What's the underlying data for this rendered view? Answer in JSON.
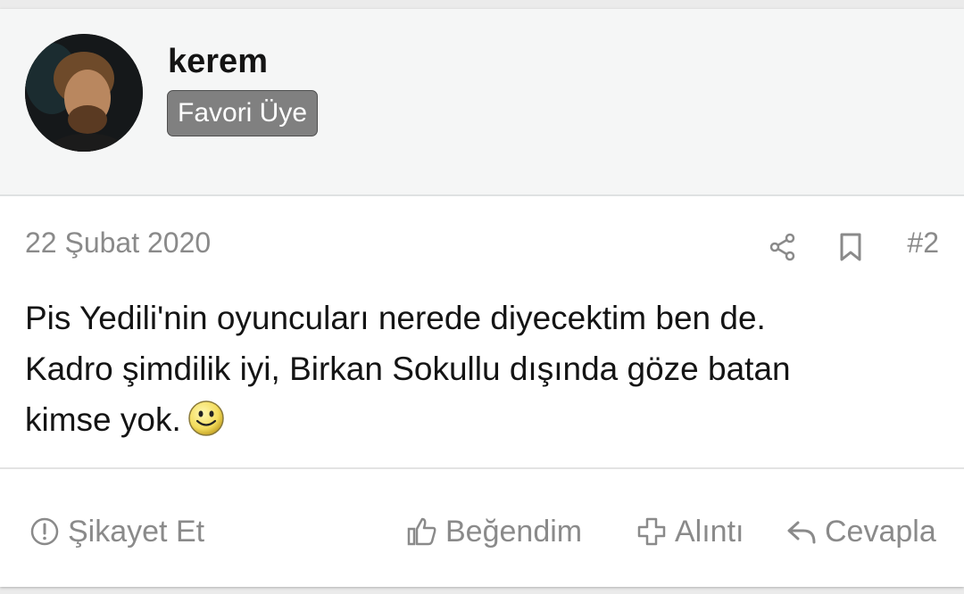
{
  "user": {
    "name": "kerem",
    "badge": "Favori Üye"
  },
  "post": {
    "date": "22 Şubat 2020",
    "number": "#2",
    "body_lines": [
      "Pis Yedili'nin oyuncuları nerede diyecektim ben de.",
      "Kadro şimdilik iyi, Birkan Sokullu dışında göze batan",
      "kimse yok."
    ],
    "emoji": "smiley-icon"
  },
  "actions": {
    "report": "Şikayet Et",
    "like": "Beğendim",
    "quote": "Alıntı",
    "reply": "Cevapla"
  },
  "colors": {
    "header_bg": "#f5f6f6",
    "badge_bg": "#808080",
    "muted_text": "#8a8a8a",
    "text": "#141414"
  }
}
